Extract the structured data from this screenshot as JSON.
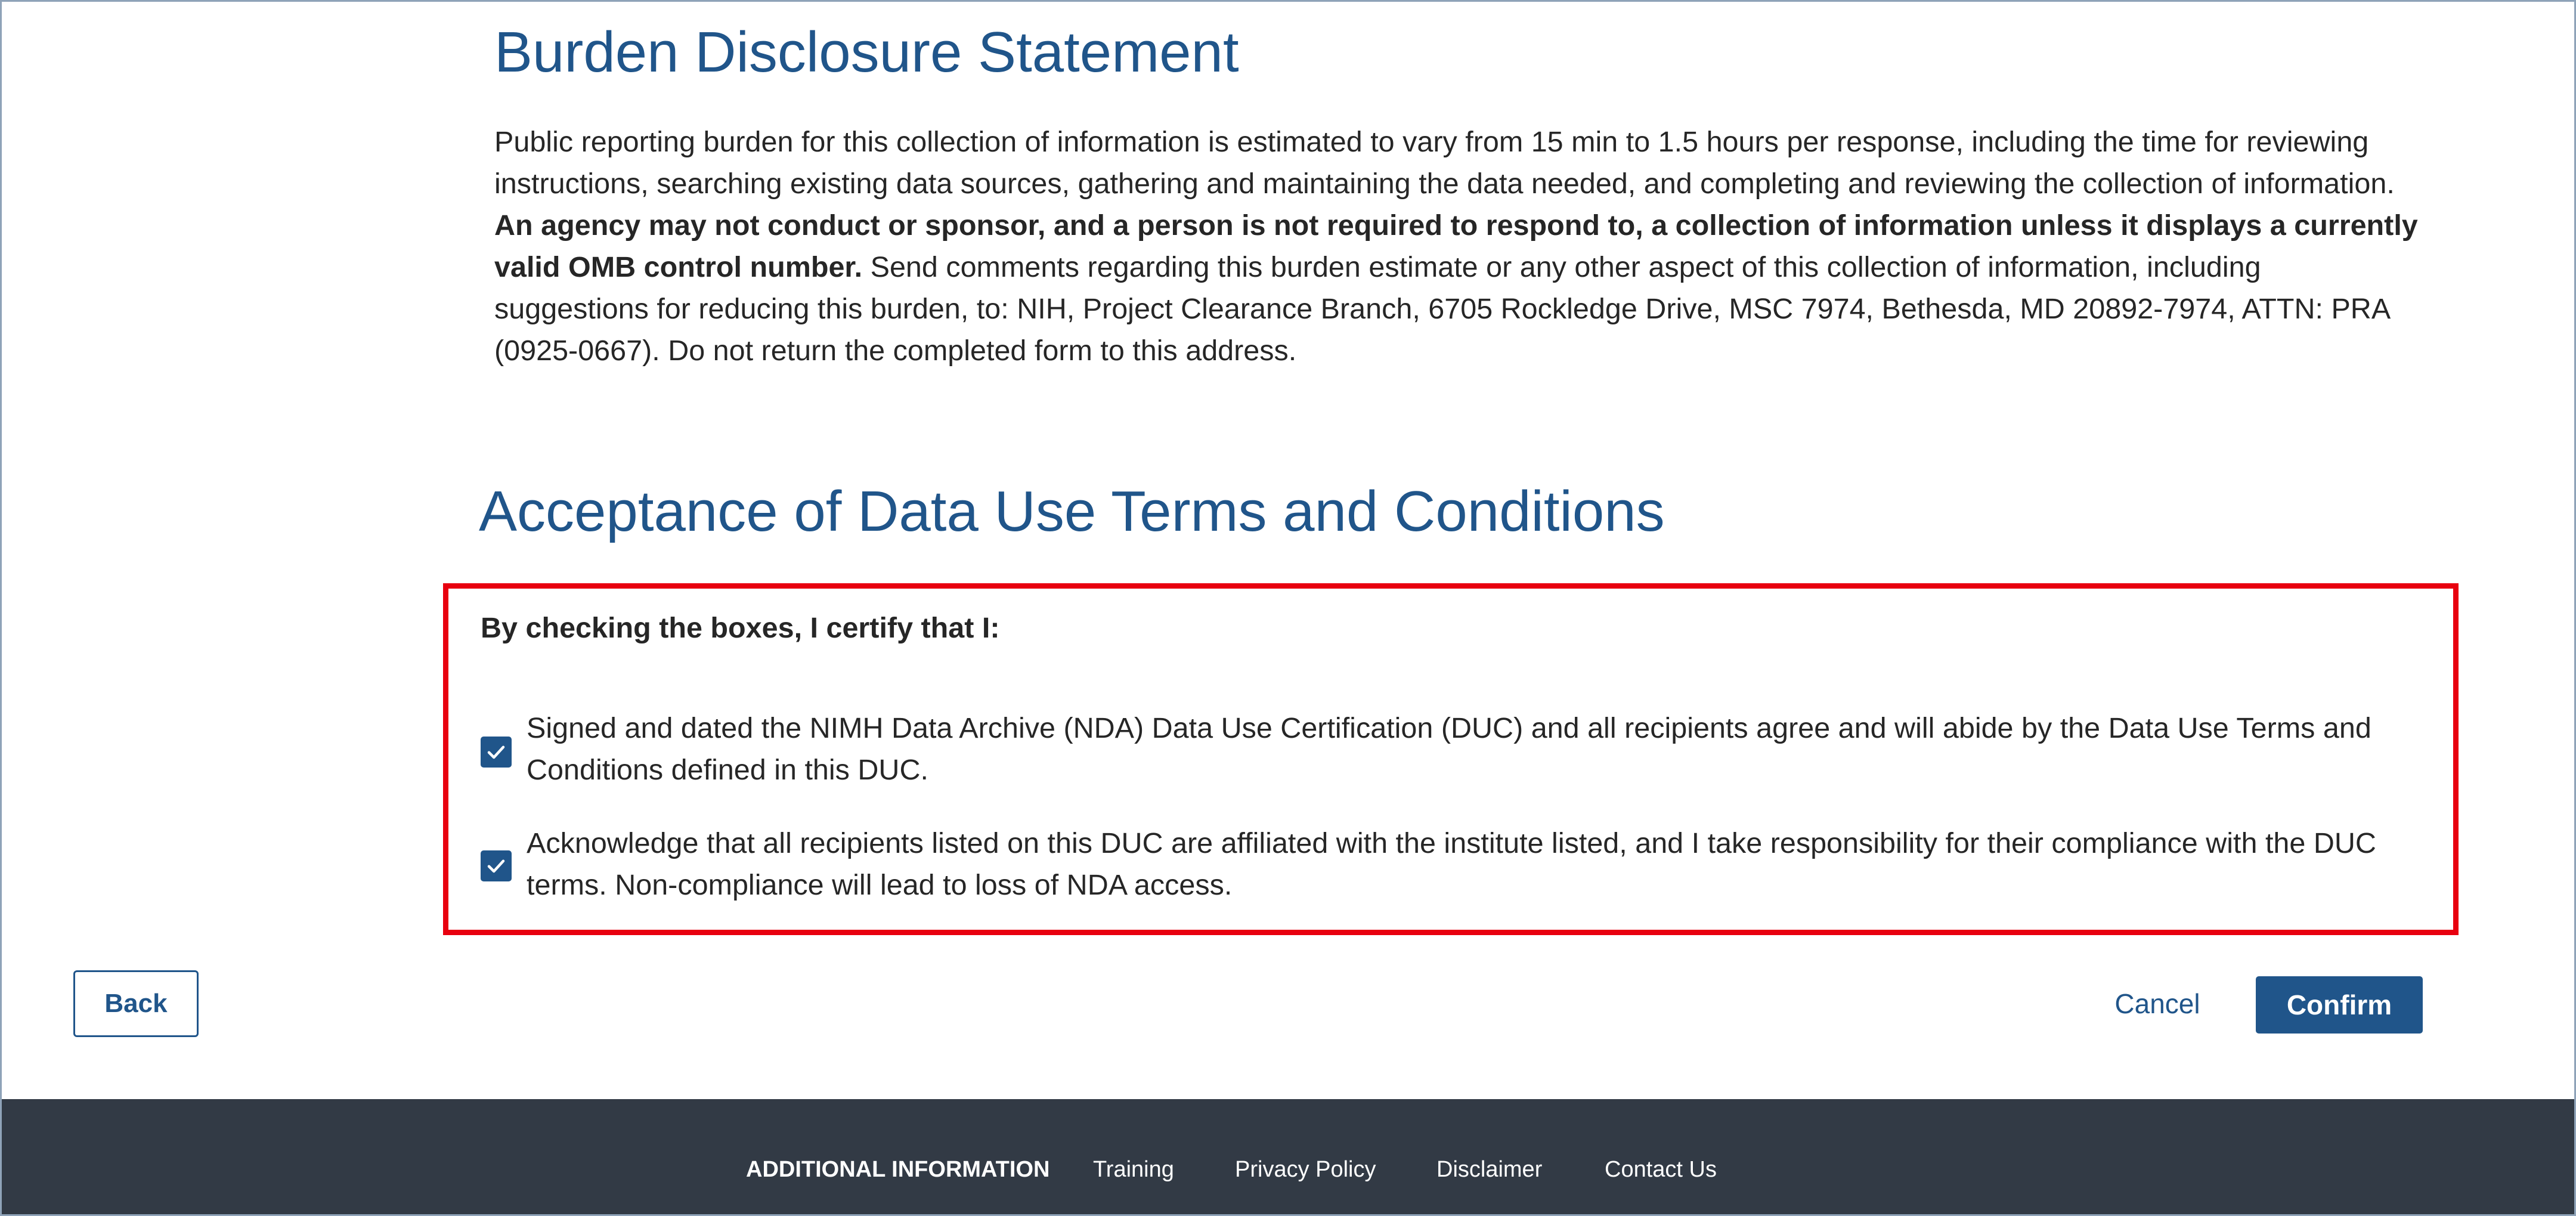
{
  "burden": {
    "title": "Burden Disclosure Statement",
    "text_before": "Public reporting burden for this collection of information is estimated to vary from 15 min to 1.5 hours per response, including the time for reviewing instructions, searching existing data sources, gathering and maintaining the data needed, and completing and reviewing the collection of information.",
    "text_bold": "An agency may not conduct or sponsor, and a person is not required to respond to, a collection of information unless it displays a currently valid OMB control number.",
    "text_after": "Send comments regarding this burden estimate or any other aspect of this collection of information, including suggestions for reducing this burden, to: NIH, Project Clearance Branch, 6705 Rockledge Drive, MSC 7974, Bethesda, MD 20892-7974, ATTN: PRA (0925-0667). Do not return the completed form to this address."
  },
  "acceptance": {
    "title": "Acceptance of Data Use Terms and Conditions",
    "intro": "By checking the boxes, I certify that I:",
    "items": [
      {
        "checked": true,
        "label": "Signed and dated the NIMH Data Archive (NDA) Data Use Certification (DUC) and all recipients agree and will abide by the Data Use Terms and Conditions defined in this DUC."
      },
      {
        "checked": true,
        "label": "Acknowledge that all recipients listed on this DUC are affiliated with the institute listed, and I take responsibility for their compliance with the DUC terms. Non-compliance will lead to loss of NDA access."
      }
    ]
  },
  "actions": {
    "back_label": "Back",
    "cancel_label": "Cancel",
    "confirm_label": "Confirm"
  },
  "footer": {
    "heading": "ADDITIONAL INFORMATION",
    "links": [
      "Training",
      "Privacy Policy",
      "Disclaimer",
      "Contact Us"
    ]
  },
  "colors": {
    "brand_blue": "#20558a",
    "highlight_red": "#e8000f",
    "footer_bg": "#323a45",
    "text": "#262626"
  },
  "icons": {
    "checkbox": "checkmark-icon"
  }
}
